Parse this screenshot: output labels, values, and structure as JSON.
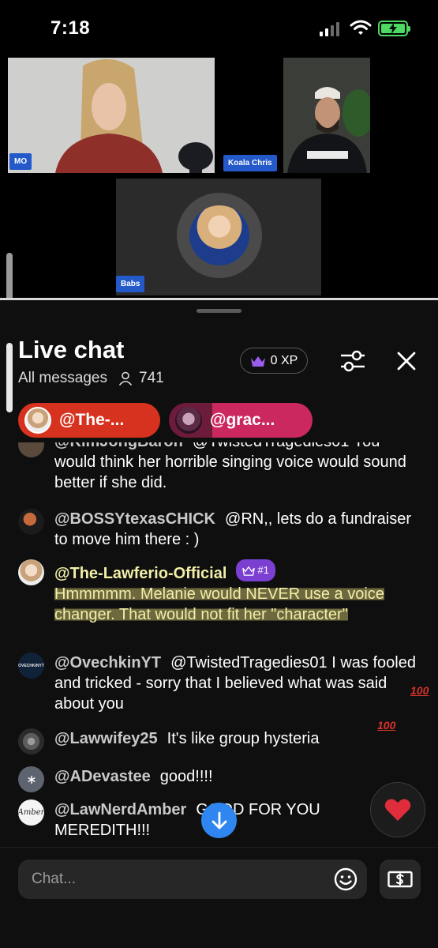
{
  "status_bar": {
    "time": "7:18"
  },
  "stage": {
    "participants": [
      {
        "name": "MO"
      },
      {
        "name": "Koala Chris"
      },
      {
        "name": "Babs"
      }
    ]
  },
  "chat": {
    "title": "Live chat",
    "filter_label": "All messages",
    "viewer_count": "741",
    "xp_label": "0 XP",
    "pinned": [
      {
        "label": "@The-..."
      },
      {
        "label": "@grac..."
      }
    ],
    "messages": [
      {
        "user": "@KimJongBaron",
        "text": "@TwistedTragedies01 You would think her horrible singing voice would sound better if she did.",
        "highlighted": false
      },
      {
        "user": "@BOSSYtexasCHICK",
        "text": "@RN,, lets do a fundraiser to move him there : )",
        "highlighted": false
      },
      {
        "user": "@The-Lawferio-Official",
        "badge": "#1",
        "text": "Hmmmmm. Melanie would NEVER use a voice changer. That would not fit her \"character\"",
        "highlighted": true
      },
      {
        "user": "@OvechkinYT",
        "text": "@TwistedTragedies01 I was fooled and tricked - sorry that I believed what was said about you",
        "highlighted": false
      },
      {
        "user": "@Lawwifey25",
        "text": "It's like group hysteria",
        "highlighted": false
      },
      {
        "user": "@ADevastee",
        "text": "good!!!!",
        "highlighted": false
      },
      {
        "user": "@LawNerdAmber",
        "text": "GOOD FOR YOU MEREDITH!!!",
        "highlighted": false
      }
    ],
    "ovechkin_avatar_text": "OVECHKINYT",
    "amber_avatar_text": "Amber",
    "hundred_emoji": "100",
    "input_placeholder": "Chat..."
  },
  "colors": {
    "accent_blue": "#2f86f0",
    "name_tag_blue": "#2359c8",
    "pill_red": "#d7321f",
    "pill_pink": "#cc2860",
    "badge_purple": "#7b3fd1",
    "highlight_yellow": "#f1efa8"
  },
  "icons": [
    "signal-icon",
    "wifi-icon",
    "battery-charging-icon",
    "person-icon",
    "crown-icon",
    "filter-sliders-icon",
    "close-icon",
    "heart-icon",
    "arrow-down-icon",
    "emoji-icon",
    "dollar-bill-icon"
  ]
}
